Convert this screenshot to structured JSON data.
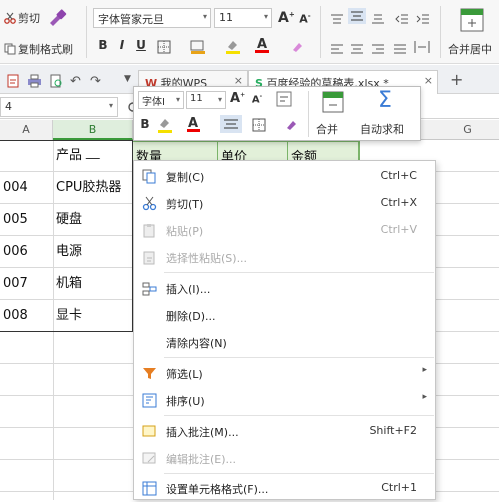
{
  "ribbon": {
    "cut_label": "剪切",
    "copy_label": "复制",
    "format_painter_label": "格式刷",
    "font_name": "字体管家元旦",
    "font_size": "11",
    "merge_label": "合并居中"
  },
  "tabs": [
    {
      "label": "我的WPS"
    },
    {
      "label": "百度经验的草稿表.xlsx *"
    }
  ],
  "formula_bar": {
    "name_box": "4"
  },
  "columns": [
    "A",
    "B",
    "G"
  ],
  "header_cells": {
    "b": "产品",
    "c": "数量",
    "d": "单价",
    "e": "金额"
  },
  "rows": [
    {
      "a": "004",
      "b": "CPU胶热器"
    },
    {
      "a": "005",
      "b": "硬盘"
    },
    {
      "a": "006",
      "b": "电源"
    },
    {
      "a": "007",
      "b": "机箱"
    },
    {
      "a": "008",
      "b": "显卡"
    }
  ],
  "mini_toolbar": {
    "font_name": "字体I",
    "font_size": "11",
    "merge_label": "合并",
    "autosum_label": "自动求和"
  },
  "context_menu": [
    {
      "label": "复制(C)",
      "shortcut": "Ctrl+C",
      "enabled": true,
      "icon": "copy-icon"
    },
    {
      "label": "剪切(T)",
      "shortcut": "Ctrl+X",
      "enabled": true,
      "icon": "scissors-icon"
    },
    {
      "label": "粘贴(P)",
      "shortcut": "Ctrl+V",
      "enabled": false,
      "icon": "paste-icon"
    },
    {
      "label": "选择性粘贴(S)...",
      "shortcut": "",
      "enabled": false,
      "icon": "paste-special-icon"
    },
    {
      "label": "插入(I)...",
      "shortcut": "",
      "enabled": true,
      "icon": "insert-icon"
    },
    {
      "label": "删除(D)...",
      "shortcut": "",
      "enabled": true,
      "icon": ""
    },
    {
      "label": "清除内容(N)",
      "shortcut": "",
      "enabled": true,
      "icon": ""
    },
    {
      "label": "筛选(L)",
      "shortcut": "",
      "enabled": true,
      "icon": "filter-icon"
    },
    {
      "label": "排序(U)",
      "shortcut": "",
      "enabled": true,
      "icon": "sort-icon"
    },
    {
      "label": "插入批注(M)...",
      "shortcut": "Shift+F2",
      "enabled": true,
      "icon": "comment-icon"
    },
    {
      "label": "编辑批注(E)...",
      "shortcut": "",
      "enabled": false,
      "icon": "edit-comment-icon"
    },
    {
      "label": "设置单元格格式(F)...",
      "shortcut": "Ctrl+1",
      "enabled": true,
      "icon": "format-cells-icon"
    }
  ]
}
